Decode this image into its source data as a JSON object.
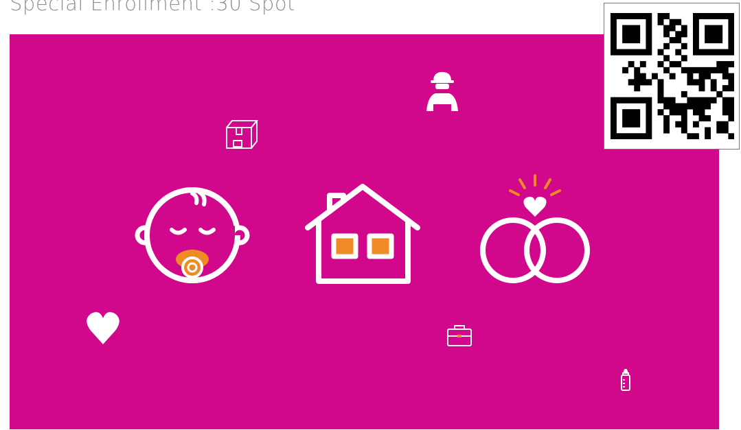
{
  "page": {
    "title": "Special Enrollment :30 Spot"
  },
  "video": {
    "background_color": "#d1088b",
    "accent_color": "#f08a24",
    "icons": [
      "worker-icon",
      "box-icon",
      "baby-icon",
      "house-icon",
      "wedding-rings-icon",
      "heart-icon",
      "briefcase-icon",
      "baby-bottle-icon"
    ]
  },
  "qr": {
    "icon": "qr-code-icon"
  }
}
